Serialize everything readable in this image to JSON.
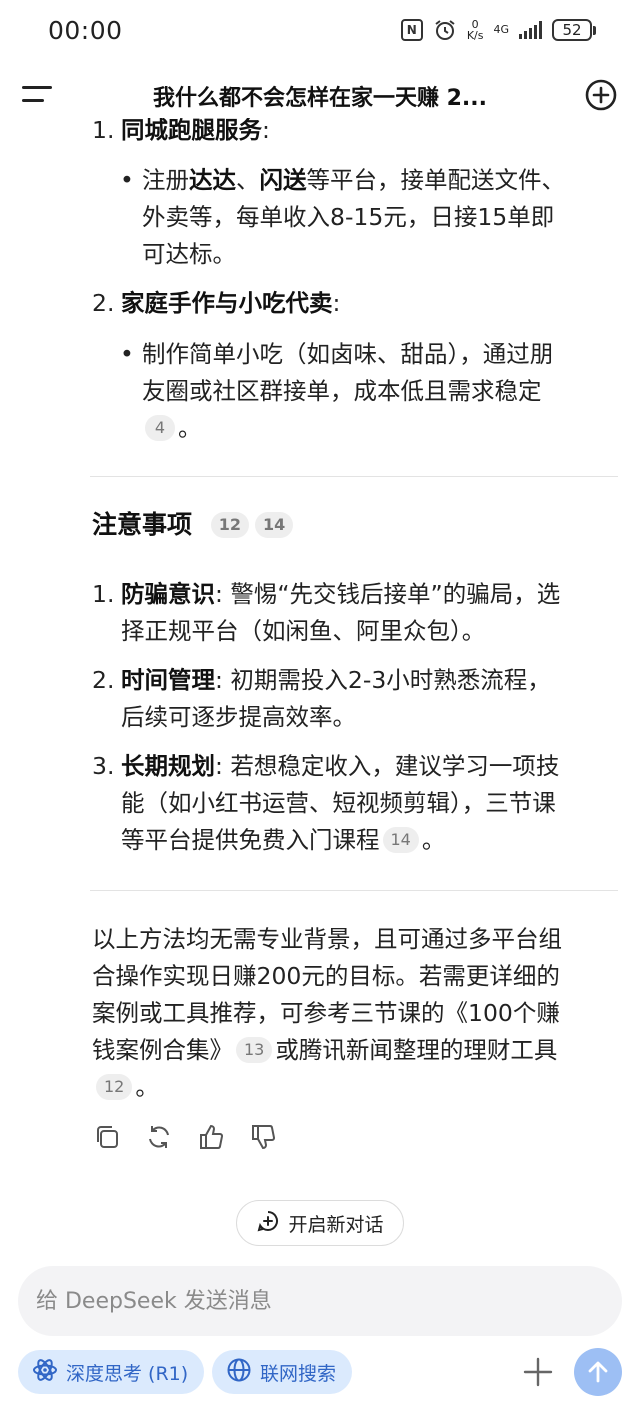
{
  "status_bar": {
    "time": "00:00",
    "net_speed_value": "0",
    "net_speed_unit": "K/s",
    "network_type": "4G",
    "battery": "52",
    "nfc_label": "N"
  },
  "header": {
    "title": "我什么都不会怎样在家一天赚 2..."
  },
  "content": {
    "section1": {
      "item1_num": "1.",
      "item1_title_partial": "同城跑腿服务",
      "item1_colon": ":",
      "item1_bullet_pre": "注册",
      "item1_bullet_b1": "达达",
      "item1_bullet_sep": "、",
      "item1_bullet_b2": "闪送",
      "item1_bullet_line1_rest": "等平台，接单配送文件、",
      "item1_bullet_line2": "外卖等，每单收入8-15元，日接15单即",
      "item1_bullet_line3": "可达标。",
      "item2_num": "2.",
      "item2_title": "家庭手作与小吃代卖",
      "item2_colon": ":",
      "item2_bullet_line1": "制作简单小吃（如卤味、甜品），通过朋",
      "item2_bullet_line2": "友圈或社区群接单，成本低且需求稳定",
      "item2_cite": "4",
      "item2_end": "。"
    },
    "notes": {
      "heading": "注意事项",
      "cite_a": "12",
      "cite_b": "14",
      "n1_num": "1.",
      "n1_title": "防骗意识",
      "n1_line1_rest": ":  警惕“先交钱后接单”的骗局，选",
      "n1_line2": "择正规平台（如闲鱼、阿里众包）。",
      "n2_num": "2.",
      "n2_title": "时间管理",
      "n2_line1_rest": ":  初期需投入2-3小时熟悉流程，",
      "n2_line2": "后续可逐步提高效率。",
      "n3_num": "3.",
      "n3_title": "长期规划",
      "n3_line1_rest": ":  若想稳定收入，建议学习一项技",
      "n3_line2": "能（如小红书运营、短视频剪辑），三节课",
      "n3_line3": "等平台提供免费入门课程",
      "n3_cite": "14",
      "n3_end": "。"
    },
    "summary": {
      "line1": "以上方法均无需专业背景，且可通过多平台组",
      "line2": "合操作实现日赚200元的目标。若需更详细的",
      "line3": "案例或工具推荐，可参考三节课的《100个赚",
      "line4_pre": "钱案例合集》",
      "line4_cite": "13",
      "line4_post": "或腾讯新闻整理的理财工具",
      "line5_cite": "12",
      "line5_end": "。"
    }
  },
  "actions": {
    "copy_icon": "copy-icon",
    "regenerate_icon": "refresh-icon",
    "like_icon": "thumbs-up-icon",
    "dislike_icon": "thumbs-down-icon"
  },
  "new_chat_button": {
    "label": "开启新对话"
  },
  "composer": {
    "placeholder": "给 DeepSeek 发送消息",
    "deep_think_label": "深度思考 (R1)",
    "web_search_label": "联网搜索"
  },
  "colors": {
    "accent": "#3166c6",
    "chip_bg": "#dbeafd",
    "send_bg": "#9dbff4",
    "citation_bg": "#eeeeee"
  }
}
